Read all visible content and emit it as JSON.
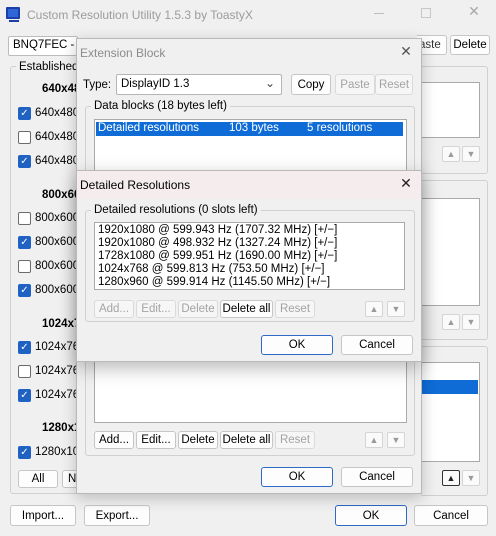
{
  "main": {
    "title": "Custom Resolution Utility 1.5.3 by ToastyX",
    "monitor": "BNQ7FEC - XL",
    "paste_label": "aste",
    "delete_label": "Delete",
    "established_label": "Established",
    "groups": [
      {
        "heading": "640x48",
        "items": [
          {
            "label": "640x480",
            "checked": true
          },
          {
            "label": "640x480",
            "checked": false
          },
          {
            "label": "640x480",
            "checked": true
          }
        ]
      },
      {
        "heading": "800x60",
        "items": [
          {
            "label": "800x600",
            "checked": false
          },
          {
            "label": "800x600",
            "checked": true
          },
          {
            "label": "800x600",
            "checked": false
          },
          {
            "label": "800x600",
            "checked": true
          }
        ]
      },
      {
        "heading": "1024x7",
        "items": [
          {
            "label": "1024x76",
            "checked": true
          },
          {
            "label": "1024x76",
            "checked": false
          },
          {
            "label": "1024x76",
            "checked": true
          }
        ]
      },
      {
        "heading": "1280x1",
        "items": [
          {
            "label": "1280x10",
            "checked": true
          }
        ]
      }
    ],
    "all_label": "All",
    "none_label": "N",
    "import_label": "Import...",
    "export_label": "Export...",
    "ok_label": "OK",
    "cancel_label": "Cancel",
    "up_arrow": "▲",
    "down_arrow": "▼"
  },
  "extension_block": {
    "title": "Extension Block",
    "type_label": "Type:",
    "type_value": "DisplayID 1.3",
    "copy_label": "Copy",
    "paste_label": "Paste",
    "reset_label": "Reset",
    "data_blocks_label": "Data blocks (18 bytes left)",
    "blocks": [
      {
        "name": "Detailed resolutions",
        "size": "103 bytes",
        "count": "5 resolutions"
      }
    ],
    "add_label": "Add...",
    "edit_label": "Edit...",
    "delete_label": "Delete",
    "delete_all_label": "Delete all",
    "reset2_label": "Reset",
    "ok_label": "OK",
    "cancel_label": "Cancel"
  },
  "detailed": {
    "title": "Detailed Resolutions",
    "group_label": "Detailed resolutions (0 slots left)",
    "resolutions": [
      "1920x1080 @ 599.943 Hz (1707.32 MHz) [+/−]",
      "1920x1080 @ 498.932 Hz (1327.24 MHz) [+/−]",
      "1728x1080 @ 599.951 Hz (1690.00 MHz) [+/−]",
      "1024x768 @ 599.813 Hz (753.50 MHz) [+/−]",
      "1280x960 @ 599.914 Hz (1145.50 MHz) [+/−]"
    ],
    "add_label": "Add...",
    "edit_label": "Edit...",
    "delete_label": "Delete",
    "delete_all_label": "Delete all",
    "reset_label": "Reset",
    "ok_label": "OK",
    "cancel_label": "Cancel"
  },
  "colors": {
    "accent": "#1f62c2",
    "selection": "#0f6cd6"
  }
}
